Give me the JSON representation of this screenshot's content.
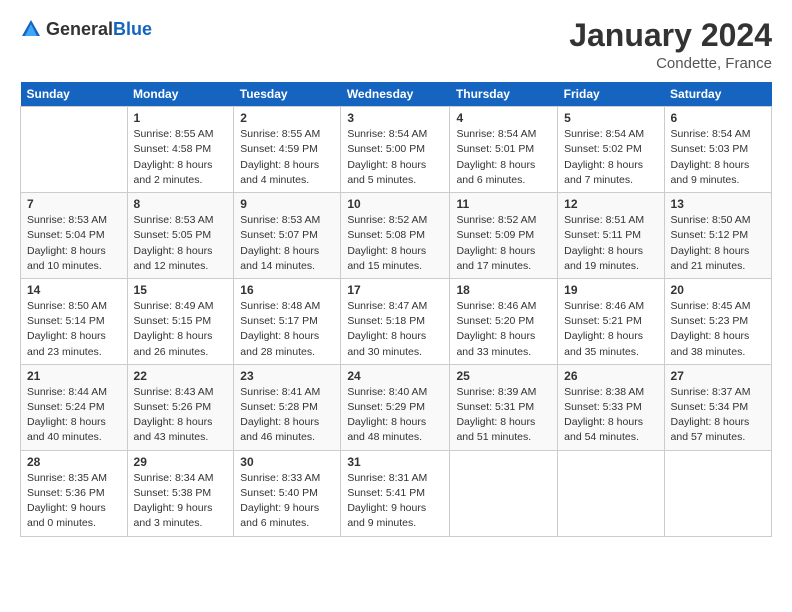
{
  "logo": {
    "text_general": "General",
    "text_blue": "Blue"
  },
  "title": "January 2024",
  "location": "Condette, France",
  "days_of_week": [
    "Sunday",
    "Monday",
    "Tuesday",
    "Wednesday",
    "Thursday",
    "Friday",
    "Saturday"
  ],
  "weeks": [
    [
      {
        "day": "",
        "info": ""
      },
      {
        "day": "1",
        "info": "Sunrise: 8:55 AM\nSunset: 4:58 PM\nDaylight: 8 hours\nand 2 minutes."
      },
      {
        "day": "2",
        "info": "Sunrise: 8:55 AM\nSunset: 4:59 PM\nDaylight: 8 hours\nand 4 minutes."
      },
      {
        "day": "3",
        "info": "Sunrise: 8:54 AM\nSunset: 5:00 PM\nDaylight: 8 hours\nand 5 minutes."
      },
      {
        "day": "4",
        "info": "Sunrise: 8:54 AM\nSunset: 5:01 PM\nDaylight: 8 hours\nand 6 minutes."
      },
      {
        "day": "5",
        "info": "Sunrise: 8:54 AM\nSunset: 5:02 PM\nDaylight: 8 hours\nand 7 minutes."
      },
      {
        "day": "6",
        "info": "Sunrise: 8:54 AM\nSunset: 5:03 PM\nDaylight: 8 hours\nand 9 minutes."
      }
    ],
    [
      {
        "day": "7",
        "info": "Sunrise: 8:53 AM\nSunset: 5:04 PM\nDaylight: 8 hours\nand 10 minutes."
      },
      {
        "day": "8",
        "info": "Sunrise: 8:53 AM\nSunset: 5:05 PM\nDaylight: 8 hours\nand 12 minutes."
      },
      {
        "day": "9",
        "info": "Sunrise: 8:53 AM\nSunset: 5:07 PM\nDaylight: 8 hours\nand 14 minutes."
      },
      {
        "day": "10",
        "info": "Sunrise: 8:52 AM\nSunset: 5:08 PM\nDaylight: 8 hours\nand 15 minutes."
      },
      {
        "day": "11",
        "info": "Sunrise: 8:52 AM\nSunset: 5:09 PM\nDaylight: 8 hours\nand 17 minutes."
      },
      {
        "day": "12",
        "info": "Sunrise: 8:51 AM\nSunset: 5:11 PM\nDaylight: 8 hours\nand 19 minutes."
      },
      {
        "day": "13",
        "info": "Sunrise: 8:50 AM\nSunset: 5:12 PM\nDaylight: 8 hours\nand 21 minutes."
      }
    ],
    [
      {
        "day": "14",
        "info": "Sunrise: 8:50 AM\nSunset: 5:14 PM\nDaylight: 8 hours\nand 23 minutes."
      },
      {
        "day": "15",
        "info": "Sunrise: 8:49 AM\nSunset: 5:15 PM\nDaylight: 8 hours\nand 26 minutes."
      },
      {
        "day": "16",
        "info": "Sunrise: 8:48 AM\nSunset: 5:17 PM\nDaylight: 8 hours\nand 28 minutes."
      },
      {
        "day": "17",
        "info": "Sunrise: 8:47 AM\nSunset: 5:18 PM\nDaylight: 8 hours\nand 30 minutes."
      },
      {
        "day": "18",
        "info": "Sunrise: 8:46 AM\nSunset: 5:20 PM\nDaylight: 8 hours\nand 33 minutes."
      },
      {
        "day": "19",
        "info": "Sunrise: 8:46 AM\nSunset: 5:21 PM\nDaylight: 8 hours\nand 35 minutes."
      },
      {
        "day": "20",
        "info": "Sunrise: 8:45 AM\nSunset: 5:23 PM\nDaylight: 8 hours\nand 38 minutes."
      }
    ],
    [
      {
        "day": "21",
        "info": "Sunrise: 8:44 AM\nSunset: 5:24 PM\nDaylight: 8 hours\nand 40 minutes."
      },
      {
        "day": "22",
        "info": "Sunrise: 8:43 AM\nSunset: 5:26 PM\nDaylight: 8 hours\nand 43 minutes."
      },
      {
        "day": "23",
        "info": "Sunrise: 8:41 AM\nSunset: 5:28 PM\nDaylight: 8 hours\nand 46 minutes."
      },
      {
        "day": "24",
        "info": "Sunrise: 8:40 AM\nSunset: 5:29 PM\nDaylight: 8 hours\nand 48 minutes."
      },
      {
        "day": "25",
        "info": "Sunrise: 8:39 AM\nSunset: 5:31 PM\nDaylight: 8 hours\nand 51 minutes."
      },
      {
        "day": "26",
        "info": "Sunrise: 8:38 AM\nSunset: 5:33 PM\nDaylight: 8 hours\nand 54 minutes."
      },
      {
        "day": "27",
        "info": "Sunrise: 8:37 AM\nSunset: 5:34 PM\nDaylight: 8 hours\nand 57 minutes."
      }
    ],
    [
      {
        "day": "28",
        "info": "Sunrise: 8:35 AM\nSunset: 5:36 PM\nDaylight: 9 hours\nand 0 minutes."
      },
      {
        "day": "29",
        "info": "Sunrise: 8:34 AM\nSunset: 5:38 PM\nDaylight: 9 hours\nand 3 minutes."
      },
      {
        "day": "30",
        "info": "Sunrise: 8:33 AM\nSunset: 5:40 PM\nDaylight: 9 hours\nand 6 minutes."
      },
      {
        "day": "31",
        "info": "Sunrise: 8:31 AM\nSunset: 5:41 PM\nDaylight: 9 hours\nand 9 minutes."
      },
      {
        "day": "",
        "info": ""
      },
      {
        "day": "",
        "info": ""
      },
      {
        "day": "",
        "info": ""
      }
    ]
  ]
}
